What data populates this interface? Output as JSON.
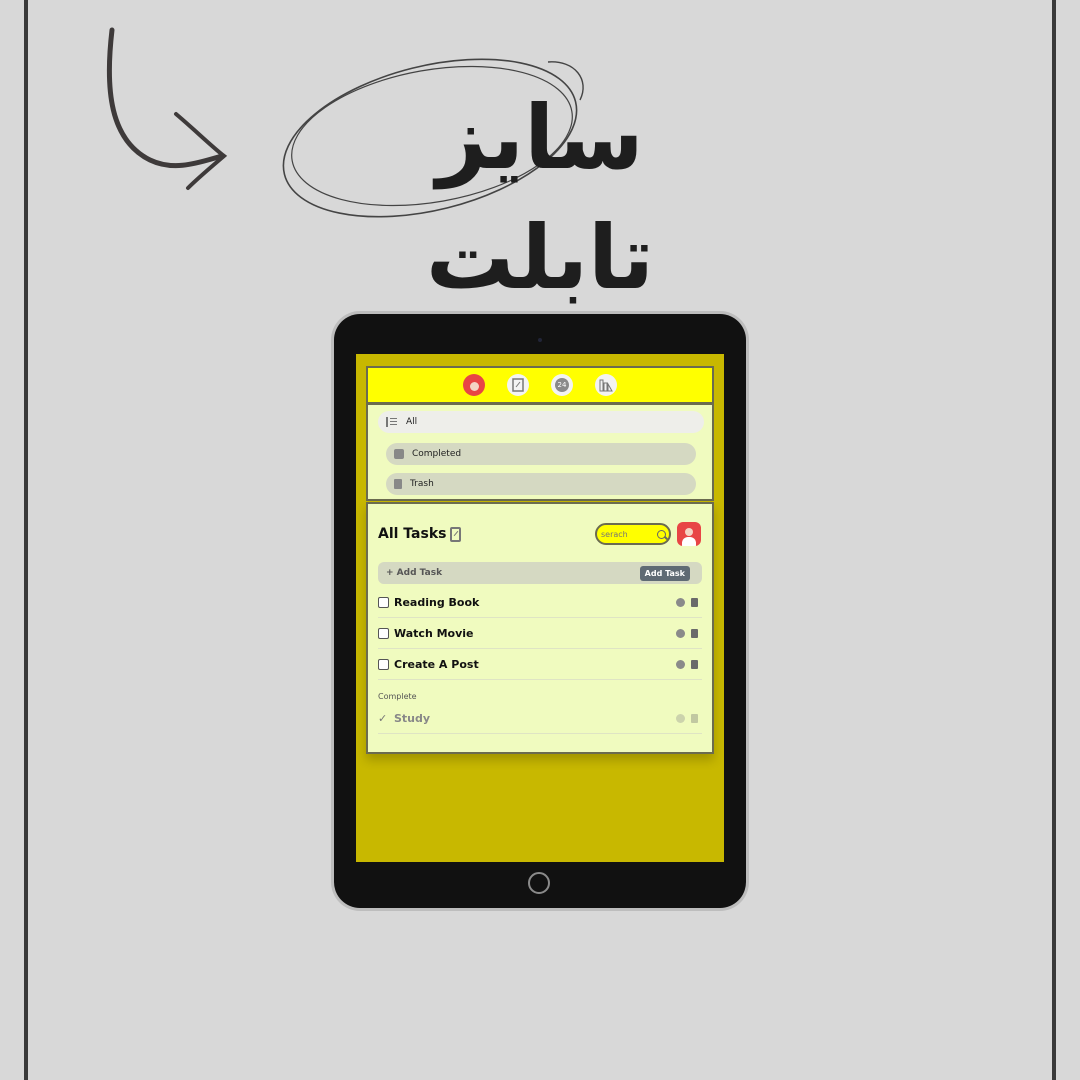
{
  "headline": {
    "text": "سايز تابلت"
  },
  "app": {
    "nav": {
      "all": "All",
      "completed": "Completed",
      "trash": "Trash"
    },
    "topbar": {
      "calendar_badge": "24"
    },
    "main": {
      "title": "All Tasks",
      "search_placeholder": "serach",
      "add_task_label": "+ Add Task",
      "add_task_button": "Add Task",
      "tasks": [
        {
          "text": "Reading Book"
        },
        {
          "text": "Watch Movie"
        },
        {
          "text": "Create A Post"
        }
      ],
      "complete_label": "Complete",
      "completed_tasks": [
        {
          "text": "Study"
        }
      ]
    }
  },
  "colors": {
    "background": "#d8d8d8",
    "screen": "#c8b800",
    "panel": "#f0fbbf",
    "accent": "#ffff00"
  }
}
